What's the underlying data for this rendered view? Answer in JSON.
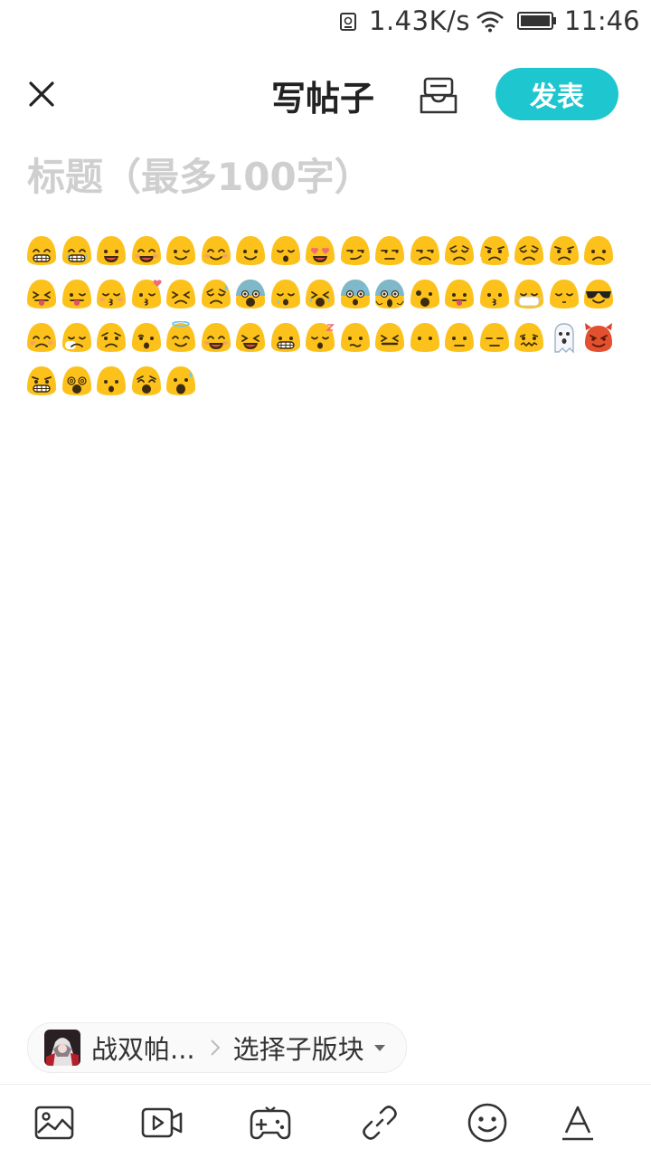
{
  "status_bar": {
    "net_speed": "1.43K/s",
    "time": "11:46",
    "icons": [
      "sd-card-icon",
      "wifi-icon",
      "battery-icon"
    ]
  },
  "header": {
    "close_icon": "close-icon",
    "title": "写帖子",
    "drafts_icon": "drafts-box-icon",
    "publish_label": "发表"
  },
  "editor": {
    "title_placeholder": "标题（最多100字）",
    "emoji_rows": [
      [
        "grin-big",
        "laugh-tears",
        "smile",
        "happy-blush",
        "wink",
        "content",
        "slight-smile",
        "relieved",
        "heart-eyes",
        "smirk",
        "unamused-side",
        "expressionless-side",
        "pensive",
        "angry-steam",
        "disappointed",
        "angry",
        "frown"
      ],
      [
        "tongue-wink",
        "tongue-squint",
        "kiss-blush",
        "kiss-heart",
        "persevere",
        "sad-sweat",
        "fearful",
        "sleepy",
        "crying",
        "anxious-sweat",
        "scream",
        "astonished",
        "tongue-out",
        "kissing",
        "mask",
        "sleeping",
        "sunglasses"
      ],
      [
        "confused-sad",
        "sneeze",
        "worried",
        "hushed",
        "innocent",
        "blush-smile",
        "laughing",
        "grimace",
        "sleeping-zzz",
        "confused",
        "tired",
        "no-mouth",
        "neutral",
        "expressionless",
        "zipper-ish",
        "ghost",
        "devil"
      ],
      [
        "grimace-angry",
        "dizzy",
        "open-mouth",
        "weary",
        "shocked"
      ]
    ]
  },
  "board": {
    "name": "战双帕...",
    "sub_board_label": "选择子版块"
  },
  "toolbar": {
    "items": [
      "image-icon",
      "video-icon",
      "game-icon",
      "link-icon",
      "emoji-icon",
      "text-format-icon"
    ]
  },
  "colors": {
    "accent": "#1ec6cf",
    "emoji_yellow": "#fcc21b",
    "placeholder": "#cfcfcf"
  }
}
